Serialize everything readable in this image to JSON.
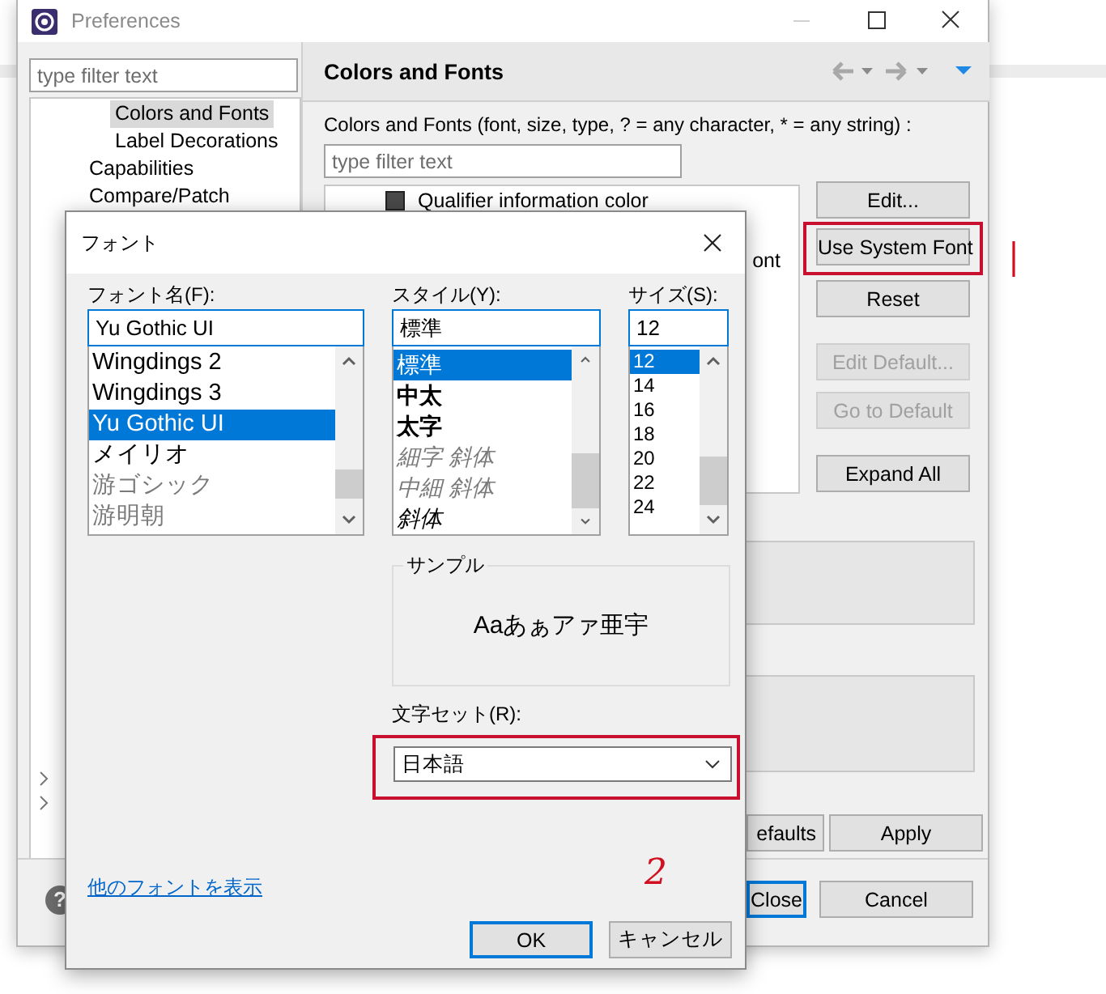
{
  "preferences": {
    "title": "Preferences",
    "filter_placeholder": "type filter text",
    "tree": [
      {
        "label": "Colors and Fonts",
        "selected": true
      },
      {
        "label": "Label Decorations",
        "selected": false
      },
      {
        "label": "Capabilities",
        "selected": false
      },
      {
        "label": "Compare/Patch",
        "selected": false
      }
    ],
    "help": "?",
    "page": {
      "title": "Colors and Fonts",
      "description": "Colors and Fonts (font, size, type, ? = any character, * = any string) :",
      "filter_placeholder": "type filter text",
      "items": [
        {
          "label": "Qualifier information color",
          "kind": "color",
          "color": "#4a4a4a"
        },
        {
          "label": "ont",
          "kind": "font"
        }
      ],
      "buttons": [
        {
          "label": "Edit...",
          "disabled": false,
          "highlighted": false
        },
        {
          "label": "Use System Font",
          "disabled": false,
          "highlighted": true
        },
        {
          "label": "Reset",
          "disabled": false,
          "highlighted": false
        },
        {
          "label": "Edit Default...",
          "disabled": true,
          "highlighted": false
        },
        {
          "label": "Go to Default",
          "disabled": true,
          "highlighted": false
        },
        {
          "label": "Expand All",
          "disabled": false,
          "highlighted": false
        }
      ],
      "apply_buttons": [
        {
          "label": "efaults"
        },
        {
          "label": "Apply"
        }
      ]
    },
    "footer_buttons": [
      {
        "label": "Close",
        "focused": true
      },
      {
        "label": "Cancel",
        "focused": false
      }
    ]
  },
  "font_dialog": {
    "title": "フォント",
    "name": {
      "label": "フォント名(F):",
      "value": "Yu Gothic UI",
      "options": [
        {
          "label": "Wingdings 2",
          "selected": false
        },
        {
          "label": "Wingdings 3",
          "selected": false
        },
        {
          "label": "Yu Gothic UI",
          "selected": true
        },
        {
          "label": "メイリオ",
          "selected": false
        },
        {
          "label": "游ゴシック",
          "selected": false
        },
        {
          "label": "游明朝",
          "selected": false
        }
      ]
    },
    "style": {
      "label": "スタイル(Y):",
      "value": "標準",
      "options": [
        {
          "label": "標準",
          "selected": true,
          "kind": "regular"
        },
        {
          "label": "中太",
          "selected": false,
          "kind": "bold"
        },
        {
          "label": "太字",
          "selected": false,
          "kind": "bold"
        },
        {
          "label": "細字 斜体",
          "selected": false,
          "kind": "light-italic"
        },
        {
          "label": "中細 斜体",
          "selected": false,
          "kind": "light-italic"
        },
        {
          "label": "斜体",
          "selected": false,
          "kind": "italic"
        }
      ]
    },
    "size": {
      "label": "サイズ(S):",
      "value": "12",
      "options": [
        {
          "label": "12",
          "selected": true
        },
        {
          "label": "14",
          "selected": false
        },
        {
          "label": "16",
          "selected": false
        },
        {
          "label": "18",
          "selected": false
        },
        {
          "label": "20",
          "selected": false
        },
        {
          "label": "22",
          "selected": false
        },
        {
          "label": "24",
          "selected": false
        }
      ]
    },
    "sample": {
      "label": "サンプル",
      "text": "Aaあぁアァ亜宇"
    },
    "charset": {
      "label": "文字セット(R):",
      "value": "日本語",
      "highlighted": true
    },
    "link": "他のフォントを表示",
    "buttons": [
      {
        "label": "OK",
        "focused": true
      },
      {
        "label": "キャンセル",
        "focused": false
      }
    ]
  },
  "annotation": {
    "text": "2"
  }
}
